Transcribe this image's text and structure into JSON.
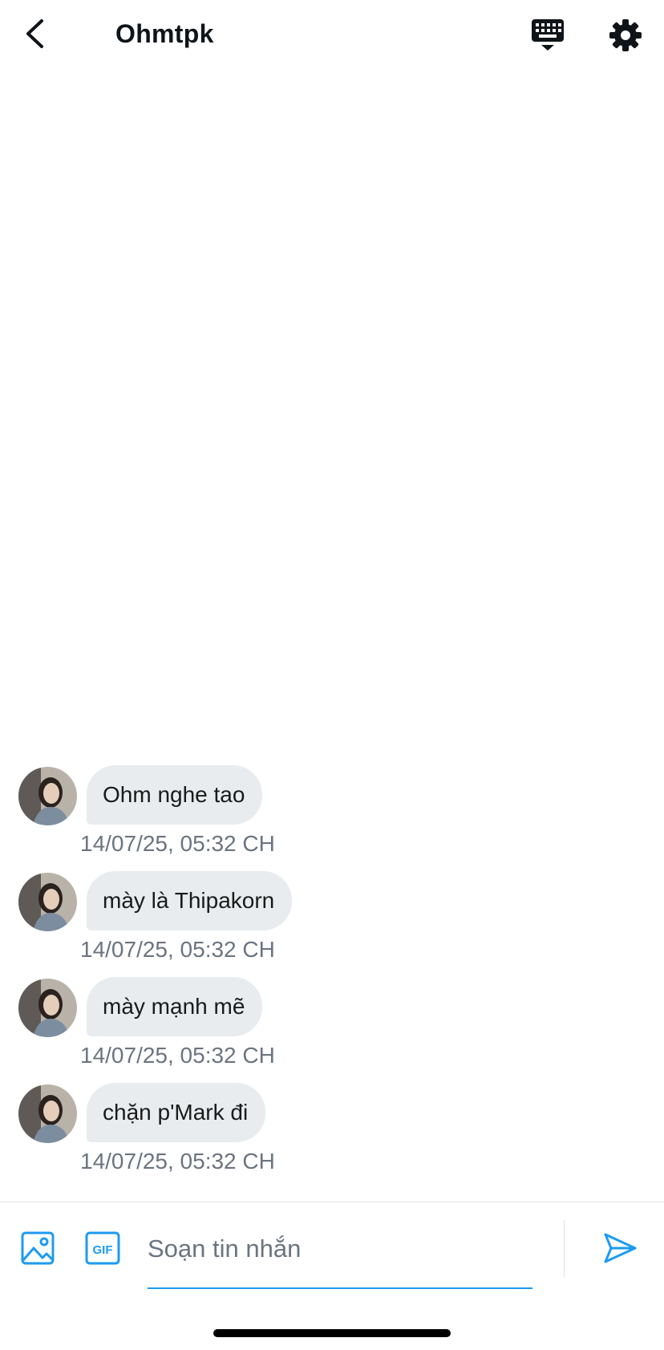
{
  "header": {
    "title": "Ohmtpk"
  },
  "messages": [
    {
      "text": "Ohm nghe tao",
      "timestamp": "14/07/25, 05:32 CH"
    },
    {
      "text": "mày là Thipakorn",
      "timestamp": "14/07/25, 05:32 CH"
    },
    {
      "text": "mày mạnh mẽ",
      "timestamp": "14/07/25, 05:32 CH"
    },
    {
      "text": "chặn p'Mark đi",
      "timestamp": "14/07/25, 05:32 CH"
    }
  ],
  "composer": {
    "placeholder": "Soạn tin nhắn",
    "value": ""
  },
  "icons": {
    "back": "chevron-left-icon",
    "keyboard": "keyboard-icon",
    "settings": "gear-icon",
    "image": "image-icon",
    "gif": "gif-icon",
    "send": "send-icon"
  },
  "colors": {
    "accent": "#1d9bf0",
    "bubble": "#e8ecef",
    "muted_text": "#6b7480"
  }
}
